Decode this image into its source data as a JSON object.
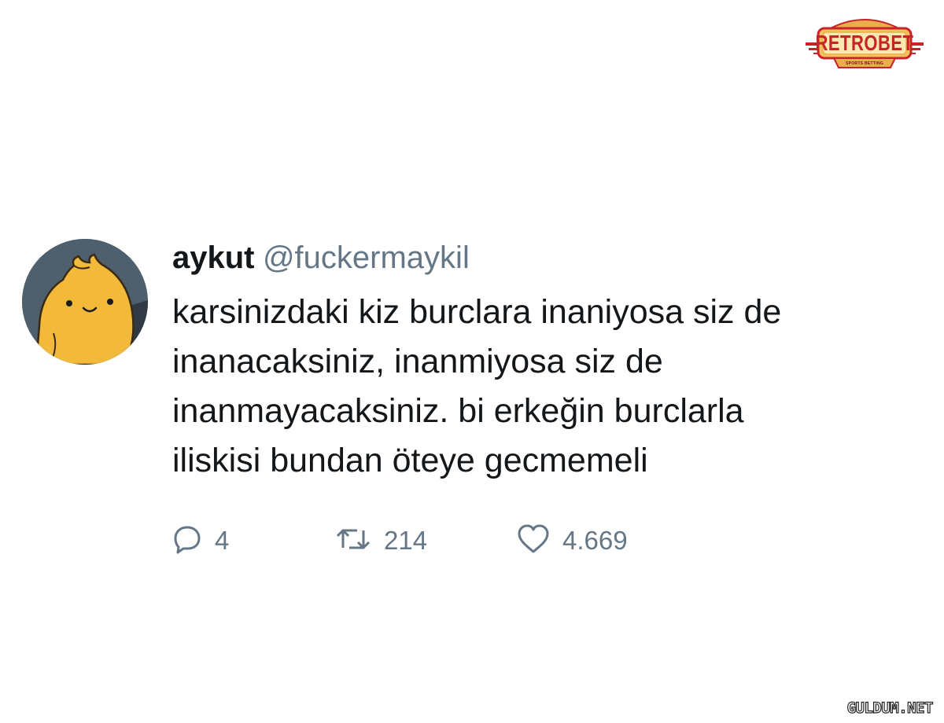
{
  "brand": {
    "name": "RETROBET",
    "tagline": "SPORTS BETTING",
    "colors": {
      "red": "#c8222a",
      "gold": "#e8b04a",
      "dark": "#5a1a10"
    }
  },
  "tweet": {
    "avatar_icon": "cartoon-chick-avatar",
    "display_name": "aykut",
    "handle": "@fuckermaykil",
    "text_lines": [
      "karsinizdaki kiz burclara inaniyosa siz de",
      "inanacaksiniz, inanmiyosa siz de",
      "inanmayacaksiniz. bi erkeğin burclarla",
      "iliskisi bundan öteye gecmemeli"
    ],
    "actions": {
      "reply": {
        "icon": "reply-icon",
        "count": "4"
      },
      "retweet": {
        "icon": "retweet-icon",
        "count": "214"
      },
      "like": {
        "icon": "heart-icon",
        "count": "4.669"
      }
    }
  },
  "watermark": "GULDUM.NET",
  "colors": {
    "text": "#14171a",
    "secondary": "#657786",
    "avatar_bg": "#4e5f6e",
    "avatar_fg": "#f2b93b"
  }
}
